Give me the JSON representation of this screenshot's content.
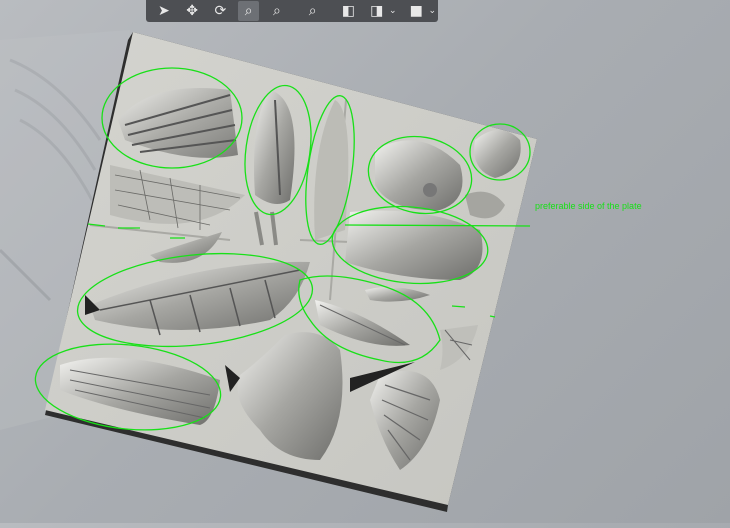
{
  "toolbar": {
    "tools": [
      {
        "name": "select",
        "icon": "cursor-arrow-icon",
        "glyph": "➤"
      },
      {
        "name": "move",
        "icon": "move-arrows-icon",
        "glyph": "✥"
      },
      {
        "name": "rotate",
        "icon": "rotate-icon",
        "glyph": "⟳"
      },
      {
        "name": "zoom-region",
        "icon": "zoom-region-icon",
        "glyph": "⌕"
      },
      {
        "name": "zoom-out",
        "icon": "zoom-out-icon",
        "glyph": "⌕"
      },
      {
        "name": "zoom-fit",
        "icon": "zoom-fit-icon",
        "glyph": "⌕"
      },
      {
        "name": "view-iso",
        "icon": "view-cube-icon",
        "glyph": "◧"
      },
      {
        "name": "view-options",
        "icon": "view-options-icon",
        "glyph": "◨"
      },
      {
        "name": "shading",
        "icon": "shading-cube-icon",
        "glyph": "■"
      }
    ],
    "caret_glyph": "⌄"
  },
  "annotation": {
    "text": "preferable side of the plate",
    "color": "#18e018"
  },
  "colors": {
    "background": "#a9adb2",
    "plate": "#cfcfca",
    "plate_edge": "#2a2a2a",
    "markup": "#18e018",
    "relief": "#8d8d8a"
  }
}
